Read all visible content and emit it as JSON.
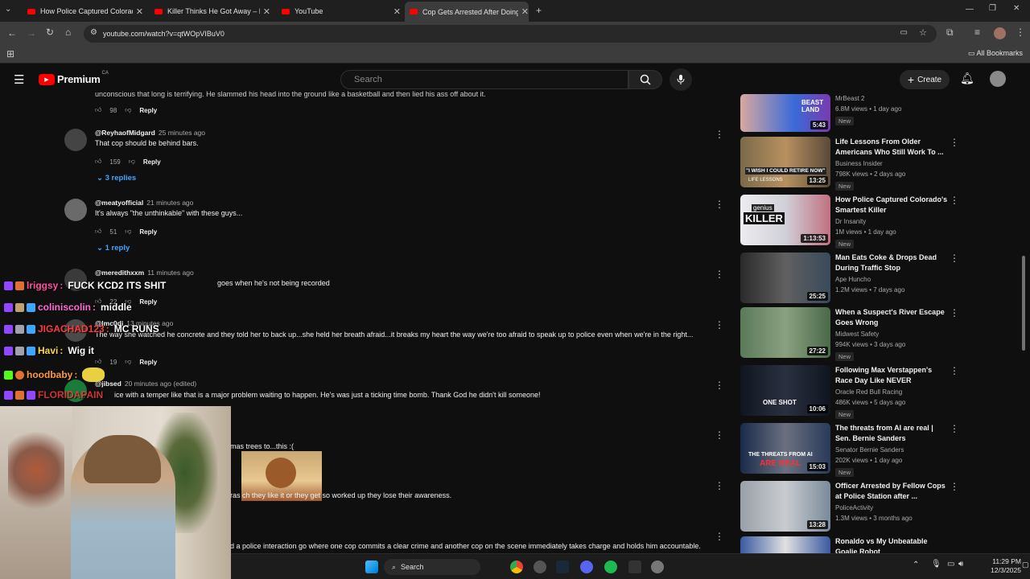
{
  "browser": {
    "tabs": [
      {
        "title": "How Police Captured Colorado",
        "active": false
      },
      {
        "title": "Killer Thinks He Got Away – Do",
        "active": false
      },
      {
        "title": "YouTube",
        "active": false
      },
      {
        "title": "Cop Gets Arrested After Doing",
        "active": true
      }
    ],
    "url": "youtube.com/watch?v=qtWOpVIBuV0",
    "bookmarks_label": "All Bookmarks"
  },
  "youtube": {
    "logo_text": "Premium",
    "region": "CA",
    "search_placeholder": "Search",
    "create_label": "Create"
  },
  "comments": [
    {
      "author": "",
      "time": "",
      "text": "unconscious that long is terrifying. He slammed his head into the ground like a basketball and then lied his ass off about it.",
      "likes": "98",
      "reply_label": "Reply"
    },
    {
      "author": "@ReyhaofMidgard",
      "time": "25 minutes ago",
      "text": "That cop should be behind bars.",
      "likes": "159",
      "reply_label": "Reply",
      "replies": "3 replies"
    },
    {
      "author": "@meatyofficial",
      "time": "21 minutes ago",
      "text": "It's always \"the unthinkable\" with these guys...",
      "likes": "51",
      "reply_label": "Reply",
      "replies": "1 reply"
    },
    {
      "author": "@meredithxxm",
      "time": "11 minutes ago",
      "text": "goes when he's not being recorded",
      "likes": "22",
      "reply_label": "Reply"
    },
    {
      "author": "@lmc0di",
      "time": "13 minutes ago",
      "text": "The way she watched he concrete and they told her to back up...she held her breath afraid...it breaks my heart the way we're too afraid to speak up to police even when we're in the right...",
      "likes": "19",
      "reply_label": "Reply"
    },
    {
      "author": "@jibsed",
      "time": "20 minutes ago (edited)",
      "text": "ice with a temper like that is a major problem waiting to happen. He's was just a ticking time bomb. Thank God he didn't kill someone!",
      "likes": "",
      "reply_label": ""
    },
    {
      "author": "",
      "time": "",
      "text": "mas trees to...this :(",
      "likes": "",
      "reply_label": ""
    },
    {
      "author": "",
      "time": "",
      "text": "ras ch they like it or they get so worked up they lose their awareness.",
      "likes": "",
      "reply_label": ""
    },
    {
      "author": "",
      "time": "",
      "text": "d a police interaction go where one cop commits a clear crime and another cop on the scene immediately takes charge and holds him accountable.",
      "likes": "",
      "reply_label": ""
    }
  ],
  "recommendations": [
    {
      "title": "",
      "channel": "MrBeast 2",
      "meta": "6.8M views • 1 day ago",
      "badge": "New",
      "duration": "5:43",
      "color": "#2a5aa8"
    },
    {
      "title": "Life Lessons From Older Americans Who Still Work To ...",
      "channel": "Business Insider",
      "meta": "798K views • 2 days ago",
      "badge": "New",
      "duration": "13:25",
      "color": "#7a6a4a"
    },
    {
      "title": "How Police Captured Colorado's Smartest Killer",
      "channel": "Dr Insanity",
      "meta": "1M views • 1 day ago",
      "badge": "New",
      "duration": "1:13:53",
      "color": "#c8c8d0"
    },
    {
      "title": "Man Eats Coke & Drops Dead During Traffic Stop",
      "channel": "Ape Huncho",
      "meta": "1.2M views • 7 days ago",
      "badge": "",
      "duration": "25:25",
      "color": "#3a3a3a"
    },
    {
      "title": "When a Suspect's River Escape Goes Wrong",
      "channel": "Midwest Safety",
      "meta": "994K views • 3 days ago",
      "badge": "New",
      "duration": "27:22",
      "color": "#4a6a4a"
    },
    {
      "title": "Following Max Verstappen's Race Day Like NEVER BEFORE...",
      "channel": "Oracle Red Bull Racing",
      "meta": "486K views • 5 days ago",
      "badge": "New",
      "duration": "10:06",
      "color": "#1a2030"
    },
    {
      "title": "The threats from AI are real | Sen. Bernie Sanders",
      "channel": "Senator Bernie Sanders",
      "meta": "202K views • 1 day ago",
      "badge": "New",
      "duration": "15:03",
      "color": "#2a3a5a"
    },
    {
      "title": "Officer Arrested by Fellow Cops at Police Station after ...",
      "channel": "PoliceActivity",
      "meta": "1.3M views • 3 months ago",
      "badge": "",
      "duration": "13:28",
      "color": "#8a8a90"
    },
    {
      "title": "Ronaldo vs My Unbeatable Goalie Robot",
      "channel": "",
      "meta": "",
      "badge": "",
      "duration": "",
      "color": "#3a5aa0"
    }
  ],
  "recommendation_overlays": {
    "beast_land": "BEAST LAND",
    "retire": "\"I WISH I COULD RETIRE NOW\"",
    "life_lessons": "LIFE LESSONS",
    "genius": "genius",
    "killer": "KILLER",
    "one_shot": "ONE SHOT",
    "threats": "THE THREATS FROM AI",
    "are_real": "ARE REAL"
  },
  "chat": [
    {
      "user": "lriggsy",
      "message": "FUCK KCD2 ITS SHIT",
      "color": "#ff4fa3"
    },
    {
      "user": "coliniscolin",
      "message": "middle",
      "color": "#ff6ad5"
    },
    {
      "user": "JIGACHAD123",
      "message": "MC RUNS",
      "color": "#ff3b3b"
    },
    {
      "user": "Havi",
      "message": "Wig it",
      "color": "#ffd84a"
    },
    {
      "user": "hoodbaby",
      "message": "",
      "color": "#ff9b3a"
    },
    {
      "user": "FLORIDAPAIN",
      "message": "",
      "color": "#ff3b3b"
    }
  ],
  "taskbar": {
    "search_label": "Search",
    "time": "11:29 PM",
    "date": "12/3/2025"
  }
}
